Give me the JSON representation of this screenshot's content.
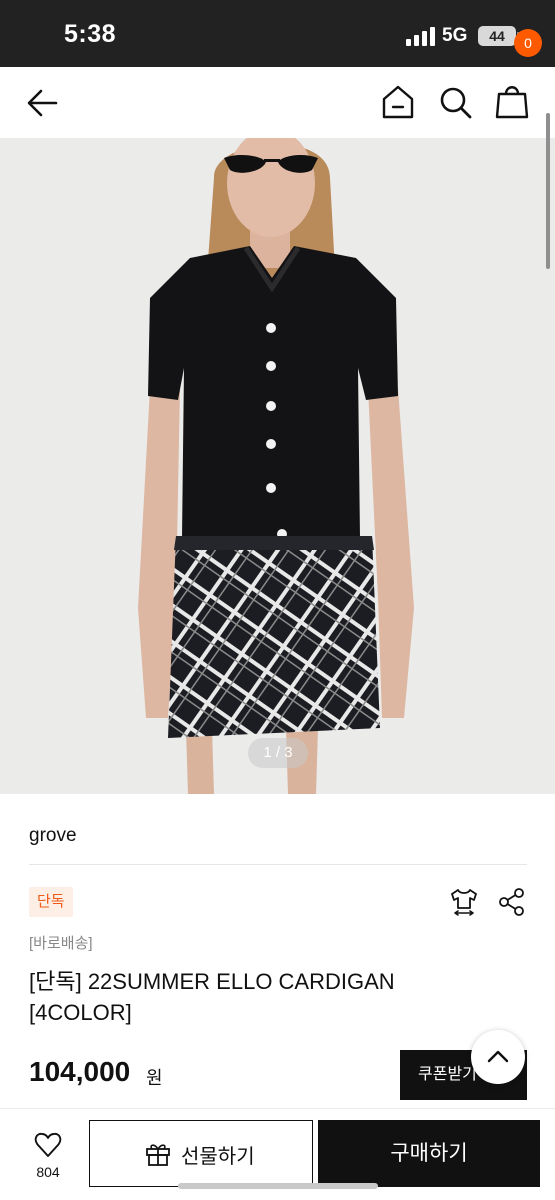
{
  "status_bar": {
    "time": "5:38",
    "network": "5G",
    "battery": "44"
  },
  "header": {
    "back_icon": "arrow-left-icon",
    "home_icon": "home-icon",
    "search_icon": "search-icon",
    "cart_icon": "shopping-bag-icon",
    "cart_count": "0",
    "accent_color": "#ff5a00"
  },
  "gallery": {
    "page_indicator": "1 / 3"
  },
  "product": {
    "brand": "grove",
    "exclusive_badge": "단독",
    "shipping_label": "[바로배송]",
    "title": "[단독] 22SUMMER ELLO CARDIGAN [4COLOR]",
    "price": "104,000",
    "price_unit": "원",
    "size_icon": "tshirt-size-icon",
    "share_icon": "share-icon"
  },
  "actions": {
    "coupon_label": "쿠폰받기",
    "scroll_top_icon": "chevron-up-icon",
    "like_count": "804",
    "gift_label": "선물하기",
    "buy_label": "구매하기"
  }
}
